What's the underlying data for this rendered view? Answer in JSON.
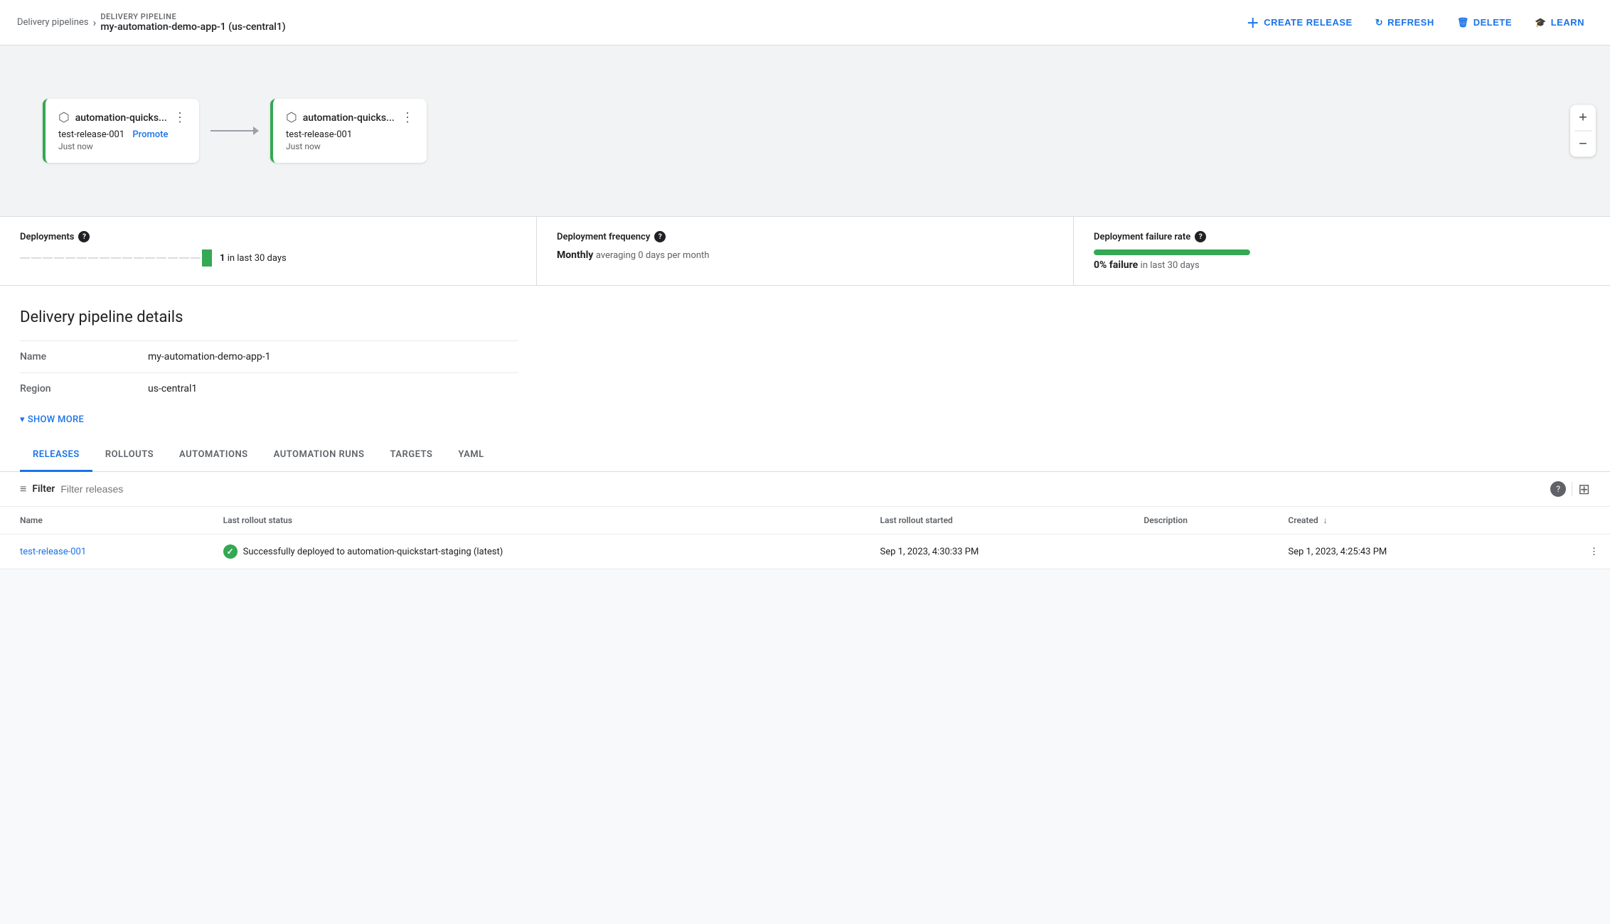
{
  "header": {
    "breadcrumb_link": "Delivery pipelines",
    "breadcrumb_sep": "›",
    "pipeline_label": "DELIVERY PIPELINE",
    "pipeline_name": "my-automation-demo-app-1 (us-central1)",
    "create_release_label": "CREATE RELEASE",
    "refresh_label": "REFRESH",
    "delete_label": "DELETE",
    "learn_label": "LEARN"
  },
  "pipeline": {
    "node1": {
      "title": "automation-quicks...",
      "release": "test-release-001",
      "promote_label": "Promote",
      "time": "Just now"
    },
    "node2": {
      "title": "automation-quicks...",
      "release": "test-release-001",
      "time": "Just now"
    },
    "zoom_plus": "+",
    "zoom_minus": "−"
  },
  "metrics": {
    "deployments": {
      "label": "Deployments",
      "count": "1",
      "suffix": "in last 30 days"
    },
    "frequency": {
      "label": "Deployment frequency",
      "value": "Monthly",
      "sub": "averaging 0 days per month"
    },
    "failure": {
      "label": "Deployment failure rate",
      "bar_percent": 100,
      "value": "0% failure",
      "sub": "in last 30 days"
    }
  },
  "details": {
    "section_title": "Delivery pipeline details",
    "fields": [
      {
        "key": "Name",
        "value": "my-automation-demo-app-1"
      },
      {
        "key": "Region",
        "value": "us-central1"
      }
    ],
    "show_more_label": "SHOW MORE"
  },
  "tabs": [
    {
      "label": "RELEASES",
      "active": true
    },
    {
      "label": "ROLLOUTS",
      "active": false
    },
    {
      "label": "AUTOMATIONS",
      "active": false
    },
    {
      "label": "AUTOMATION RUNS",
      "active": false
    },
    {
      "label": "TARGETS",
      "active": false
    },
    {
      "label": "YAML",
      "active": false
    }
  ],
  "filter": {
    "label": "Filter",
    "placeholder": "Filter releases"
  },
  "table": {
    "columns": [
      {
        "key": "name",
        "label": "Name",
        "sortable": false
      },
      {
        "key": "status",
        "label": "Last rollout status",
        "sortable": false
      },
      {
        "key": "started",
        "label": "Last rollout started",
        "sortable": false
      },
      {
        "key": "description",
        "label": "Description",
        "sortable": false
      },
      {
        "key": "created",
        "label": "Created",
        "sortable": true,
        "sort_dir": "desc"
      }
    ],
    "rows": [
      {
        "name": "test-release-001",
        "status": "Successfully deployed to automation-quickstart-staging (latest)",
        "started": "Sep 1, 2023, 4:30:33 PM",
        "description": "",
        "created": "Sep 1, 2023, 4:25:43 PM"
      }
    ]
  }
}
